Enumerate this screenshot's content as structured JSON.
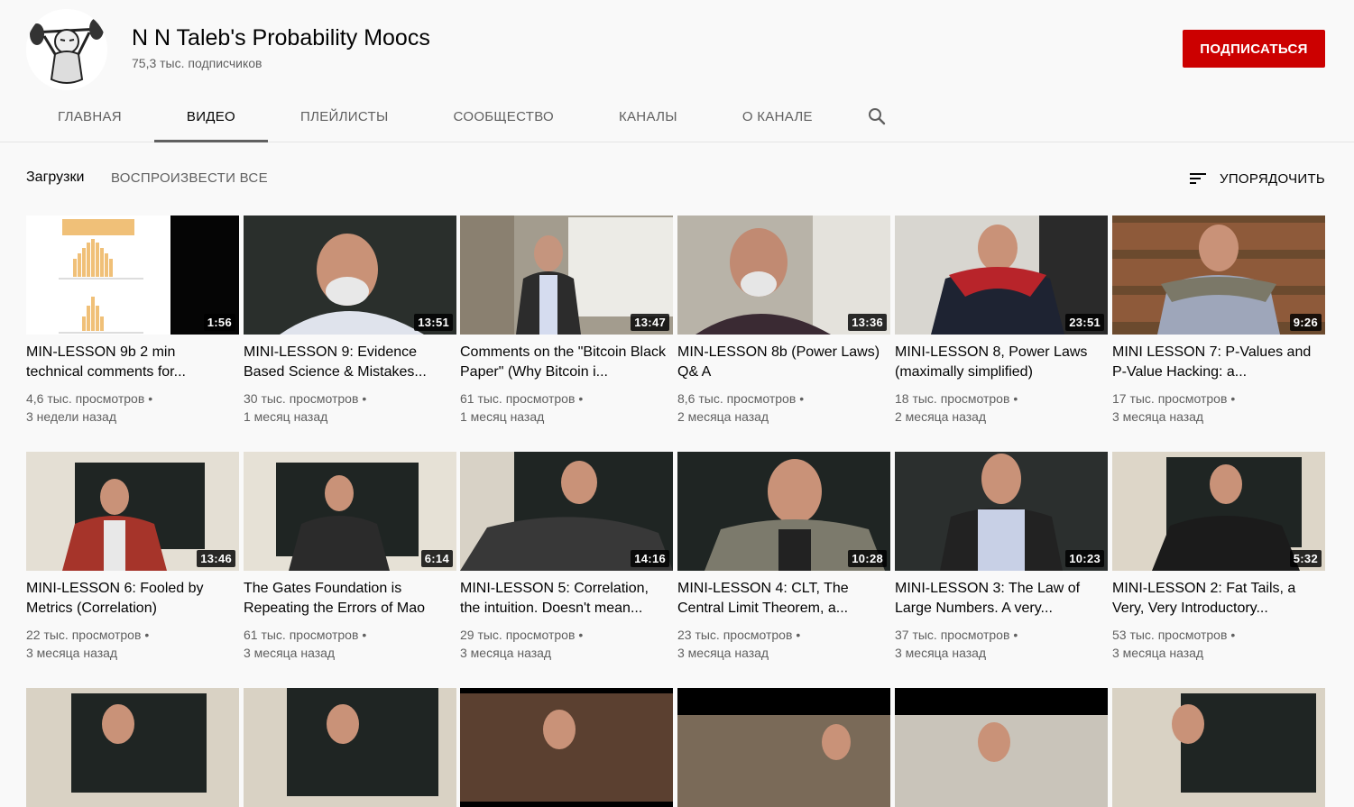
{
  "channel": {
    "title": "N N Taleb's Probability Moocs",
    "subscribers": "75,3 тыс. подписчиков",
    "subscribe_label": "ПОДПИСАТЬСЯ"
  },
  "tabs": [
    {
      "label": "ГЛАВНАЯ"
    },
    {
      "label": "ВИДЕО"
    },
    {
      "label": "ПЛЕЙЛИСТЫ"
    },
    {
      "label": "СООБЩЕСТВО"
    },
    {
      "label": "КАНАЛЫ"
    },
    {
      "label": "О КАНАЛЕ"
    }
  ],
  "active_tab": "ВИДЕО",
  "toolbar": {
    "section_title": "Загрузки",
    "play_all_label": "ВОСПРОИЗВЕСТИ ВСЕ",
    "sort_label": "УПОРЯДОЧИТЬ"
  },
  "colors": {
    "subscribe": "#cc0000",
    "text_primary": "#030303",
    "text_secondary": "#606060",
    "background": "#f9f9f9"
  },
  "videos": [
    {
      "title": "MIN-LESSON 9b 2 min technical comments for...",
      "duration": "1:56",
      "views": "4,6 тыс. просмотров",
      "age": "3 недели назад"
    },
    {
      "title": "MINI-LESSON 9: Evidence Based Science & Mistakes...",
      "duration": "13:51",
      "views": "30 тыс. просмотров",
      "age": "1 месяц назад"
    },
    {
      "title": "Comments on the \"Bitcoin Black Paper\" (Why Bitcoin i...",
      "duration": "13:47",
      "views": "61 тыс. просмотров",
      "age": "1 месяц назад"
    },
    {
      "title": "MIN-LESSON 8b (Power Laws) Q& A",
      "duration": "13:36",
      "views": "8,6 тыс. просмотров",
      "age": "2 месяца назад"
    },
    {
      "title": "MINI-LESSON 8, Power Laws (maximally simplified)",
      "duration": "23:51",
      "views": "18 тыс. просмотров",
      "age": "2 месяца назад"
    },
    {
      "title": "MINI LESSON 7: P-Values and P-Value Hacking: a...",
      "duration": "9:26",
      "views": "17 тыс. просмотров",
      "age": "3 месяца назад"
    },
    {
      "title": "MINI-LESSON 6: Fooled by Metrics (Correlation)",
      "duration": "13:46",
      "views": "22 тыс. просмотров",
      "age": "3 месяца назад"
    },
    {
      "title": "The Gates Foundation is Repeating the Errors of Mao",
      "duration": "6:14",
      "views": "61 тыс. просмотров",
      "age": "3 месяца назад"
    },
    {
      "title": "MINI-LESSON 5: Correlation, the intuition. Doesn't mean...",
      "duration": "14:16",
      "views": "29 тыс. просмотров",
      "age": "3 месяца назад"
    },
    {
      "title": "MINI-LESSON 4: CLT, The Central Limit Theorem, a...",
      "duration": "10:28",
      "views": "23 тыс. просмотров",
      "age": "3 месяца назад"
    },
    {
      "title": "MINI-LESSON 3: The Law of Large Numbers. A very...",
      "duration": "10:23",
      "views": "37 тыс. просмотров",
      "age": "3 месяца назад"
    },
    {
      "title": "MINI-LESSON 2: Fat Tails, a Very, Very Introductory...",
      "duration": "5:32",
      "views": "53 тыс. просмотров",
      "age": "3 месяца назад"
    }
  ]
}
